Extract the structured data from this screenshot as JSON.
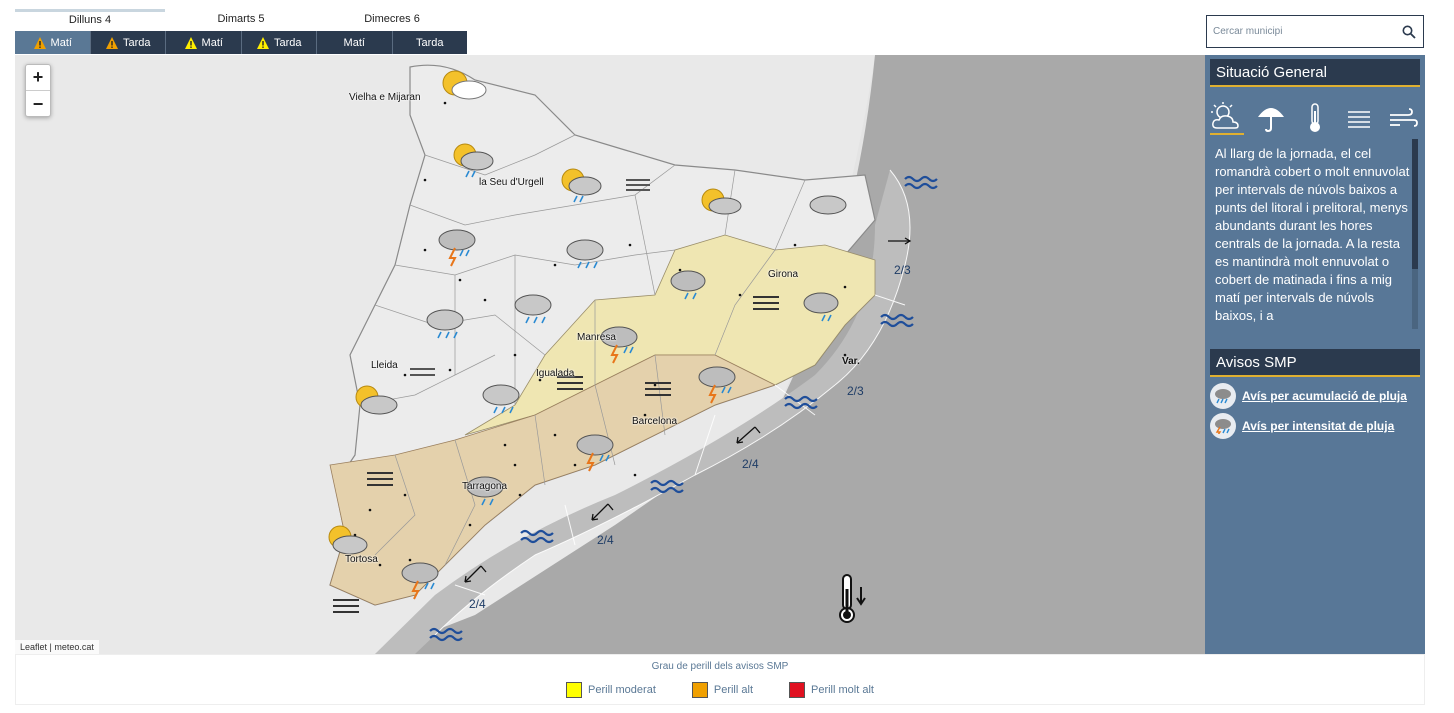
{
  "days": [
    {
      "label": "Dilluns 4",
      "active": true,
      "turns": [
        {
          "label": "Matí",
          "warning": "orange"
        },
        {
          "label": "Tarda",
          "warning": "orange"
        }
      ]
    },
    {
      "label": "Dimarts 5",
      "active": false,
      "turns": [
        {
          "label": "Matí",
          "warning": "yellow"
        },
        {
          "label": "Tarda",
          "warning": "yellow"
        }
      ]
    },
    {
      "label": "Dimecres 6",
      "active": false,
      "turns": [
        {
          "label": "Matí",
          "warning": null
        },
        {
          "label": "Tarda",
          "warning": null
        }
      ]
    }
  ],
  "search": {
    "placeholder": "Cercar municipi"
  },
  "map": {
    "zoom_in": "+",
    "zoom_out": "−",
    "attribution": {
      "leaflet": "Leaflet",
      "separator": " | ",
      "source": "meteo.cat"
    },
    "cities": [
      "Vielha e Mijaran",
      "la Seu d'Urgell",
      "Girona",
      "Manresa",
      "Lleida",
      "Igualada",
      "Barcelona",
      "Tarragona",
      "Tortosa"
    ],
    "sea_labels": [
      "2/3",
      "2/3",
      "2/4",
      "2/4",
      "2/4"
    ],
    "sea_var": "Var."
  },
  "panel": {
    "general_title": "Situació General",
    "icons": [
      "partly-cloudy-icon",
      "umbrella-icon",
      "thermometer-icon",
      "fog-icon",
      "wind-icon"
    ],
    "general_text": "Al llarg de la jornada, el cel romandrà cobert o molt ennuvolat per intervals de núvols baixos a punts del litoral i prelitoral, menys abundants durant les hores centrals de la jornada. A la resta es mantindrà molt ennuvolat o cobert de matinada i fins a mig matí per intervals de núvols baixos, i a",
    "avisos_title": "Avisos SMP",
    "avisos": [
      "Avís per acumulació de pluja",
      "Avís per intensitat de pluja"
    ]
  },
  "legend": {
    "title": "Grau de perill dels avisos SMP",
    "items": [
      {
        "label": "Perill moderat",
        "color": "#ffff00"
      },
      {
        "label": "Perill alt",
        "color": "#f0a000"
      },
      {
        "label": "Perill molt alt",
        "color": "#e01020"
      }
    ]
  },
  "colors": {
    "dark": "#2b3a4e",
    "panel": "#587797",
    "accent": "#e0b030",
    "moderate_zone": "#f1e7b4",
    "high_zone": "#e3d1ae"
  }
}
